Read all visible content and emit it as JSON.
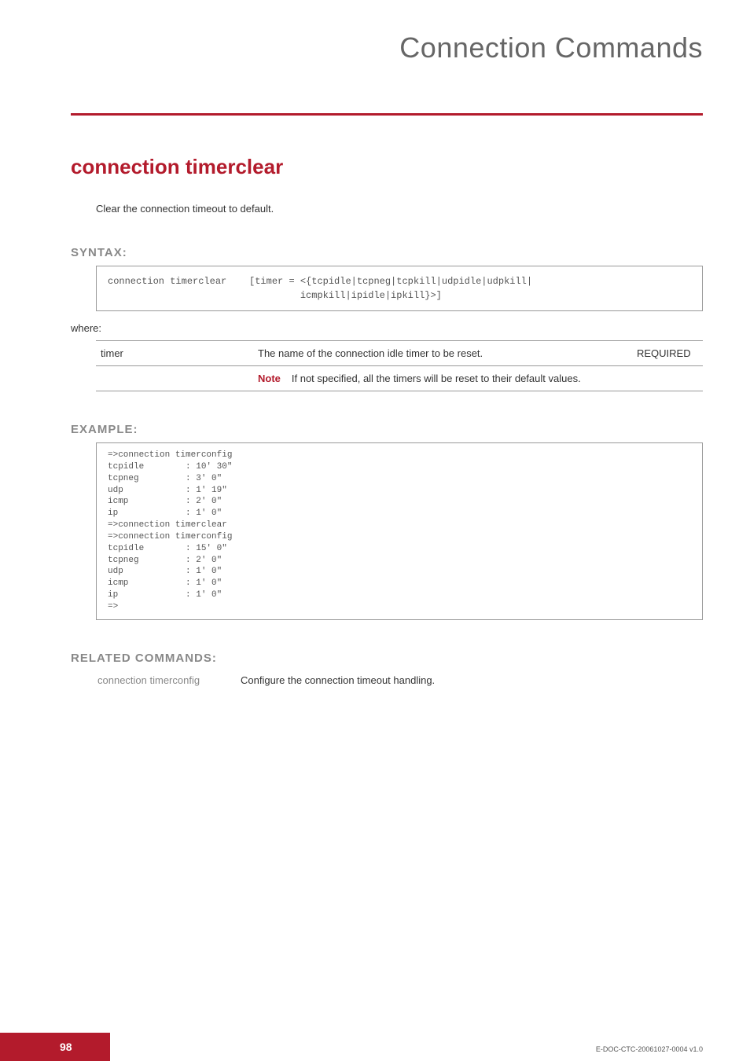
{
  "header": {
    "section_title": "Connection Commands"
  },
  "command": {
    "title": "connection timerclear",
    "description": "Clear the connection timeout to default."
  },
  "syntax": {
    "label": "SYNTAX:",
    "code": "connection timerclear    [timer = <{tcpidle|tcpneg|tcpkill|udpidle|udpkill|\n                                  icmpkill|ipidle|ipkill}>]",
    "where_label": "where:",
    "params": [
      {
        "name": "timer",
        "desc": "The name of the connection idle timer to be reset.",
        "req": "REQUIRED",
        "note_label": "Note",
        "note_text": "If not specified, all the timers will be reset to their default values."
      }
    ]
  },
  "example": {
    "label": "EXAMPLE:",
    "code": "=>connection timerconfig\ntcpidle        : 10' 30\"\ntcpneg         : 3' 0\"\nudp            : 1' 19\"\nicmp           : 2' 0\"\nip             : 1' 0\"\n=>connection timerclear\n=>connection timerconfig\ntcpidle        : 15' 0\"\ntcpneg         : 2' 0\"\nudp            : 1' 0\"\nicmp           : 1' 0\"\nip             : 1' 0\"\n=>"
  },
  "related": {
    "label": "RELATED COMMANDS:",
    "items": [
      {
        "cmd": "connection timerconfig",
        "desc": "Configure the connection timeout handling."
      }
    ]
  },
  "footer": {
    "page": "98",
    "doc": "E-DOC-CTC-20061027-0004 v1.0"
  }
}
